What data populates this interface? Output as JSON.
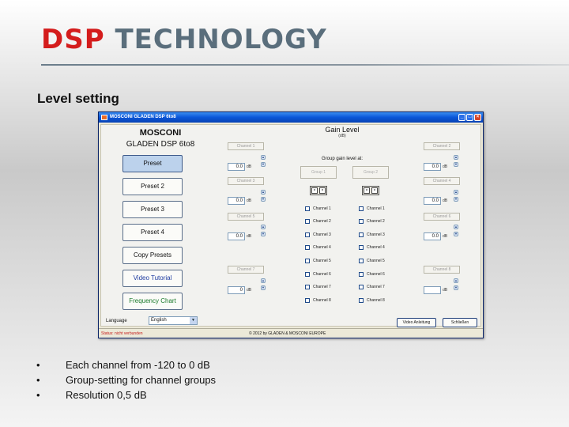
{
  "slide": {
    "title_red": "DSP",
    "title_gray": "TECHNOLOGY",
    "subtitle": "Level setting",
    "bullets": [
      "Each channel from -120 to 0 dB",
      "Group-setting for channel groups",
      "Resolution 0,5 dB"
    ]
  },
  "window": {
    "title": "MOSCONI GLADEN DSP 6to8",
    "brand": "MOSCONI",
    "model": "GLADEN DSP 6to8",
    "buttons": {
      "preset": "Preset",
      "preset2": "Preset 2",
      "preset3": "Preset 3",
      "preset4": "Preset 4",
      "copy": "Copy Presets",
      "video": "Video Tutorial",
      "frequency": "Frequency Chart"
    },
    "gain": {
      "title": "Gain Level",
      "subtitle": "(dB)",
      "group_label": "Group gain level at:",
      "group1": "Group 1",
      "group2": "Group 2",
      "db_unit": "dB",
      "left_channels": [
        {
          "label": "Channel 1",
          "value": "0.0"
        },
        {
          "label": "Channel 3",
          "value": "0.0"
        },
        {
          "label": "Channel 5",
          "value": "0.0"
        },
        {
          "label": "Channel 7",
          "value": "0"
        }
      ],
      "right_channels": [
        {
          "label": "Channel 2",
          "value": "0.0"
        },
        {
          "label": "Channel 4",
          "value": "0.0"
        },
        {
          "label": "Channel 6",
          "value": "0.0"
        },
        {
          "label": "Channel 8",
          "value": ""
        }
      ],
      "group1_checks": [
        "Channel 1",
        "Channel 2",
        "Channel 3",
        "Channel 4",
        "Channel 5",
        "Channel 6",
        "Channel 7",
        "Channel 8"
      ],
      "group2_checks": [
        "Channel 1",
        "Channel 2",
        "Channel 3",
        "Channel 4",
        "Channel 5",
        "Channel 6",
        "Channel 7",
        "Channel 8"
      ]
    },
    "language": {
      "label": "Language",
      "value": "English"
    },
    "bottom": {
      "manual": "Video Anleitung",
      "close": "Schließen"
    },
    "status": {
      "left": "Status: nicht verbunden",
      "mid": "© 2012 by GLADEN & MOSCONI EUROPE"
    },
    "colors": {
      "titlebar": "#0a56d8",
      "status_text": "#c41a1a"
    }
  }
}
